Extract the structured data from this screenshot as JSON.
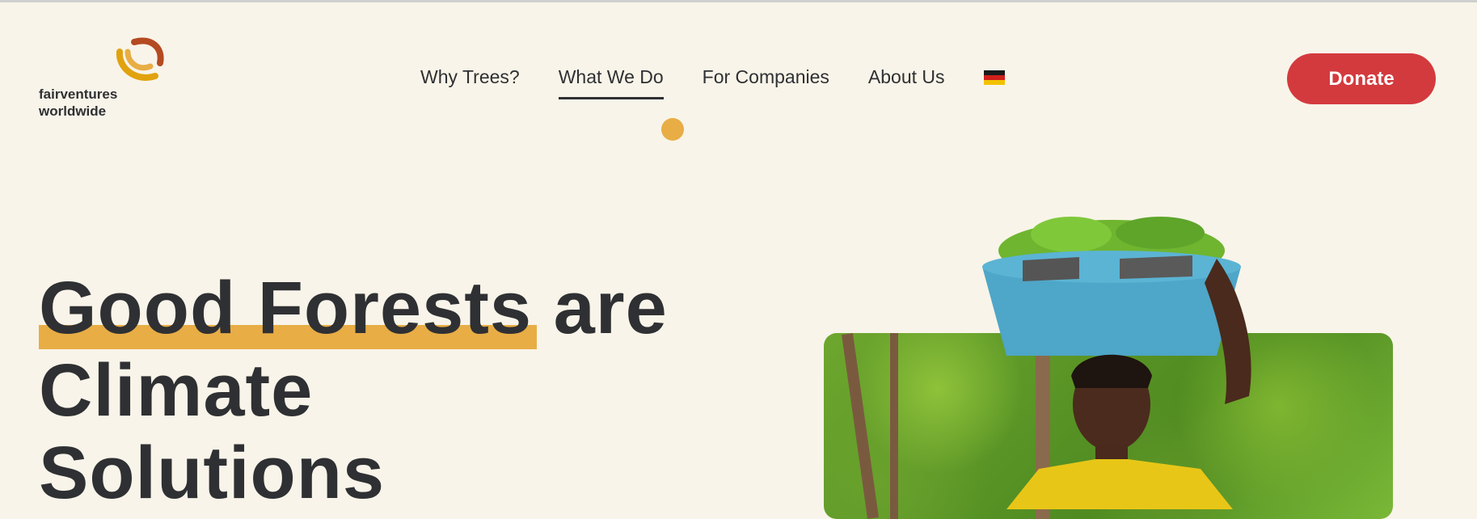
{
  "brand": {
    "name_line1": "fairventures",
    "name_line2": "worldwide",
    "colors": {
      "orange": "#e8ad45",
      "rust": "#b44a22",
      "yellow": "#e1a20f"
    }
  },
  "nav": {
    "items": [
      {
        "label": "Why Trees?",
        "active": false
      },
      {
        "label": "What We Do",
        "active": true
      },
      {
        "label": "For Companies",
        "active": false
      },
      {
        "label": "About Us",
        "active": false
      }
    ],
    "language_flag": "germany-flag-icon"
  },
  "donate": {
    "label": "Donate",
    "color": "#d33a3e"
  },
  "hero": {
    "headline_highlight": "Good Forests",
    "headline_rest_line1": " are",
    "headline_line2": "Climate",
    "headline_line3": "Solutions",
    "highlight_color": "#e8ad45"
  },
  "image": {
    "icon": "woman-carrying-seedlings-photo"
  }
}
